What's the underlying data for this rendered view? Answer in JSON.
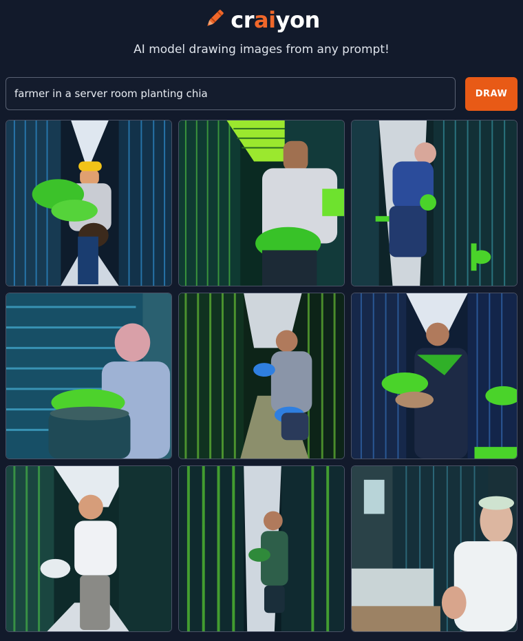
{
  "brand": {
    "name_prefix": "cr",
    "name_accent": "ai",
    "name_suffix": "yon",
    "tagline": "AI model drawing images from any prompt!",
    "logo_icon": "crayon-icon",
    "accent_color": "#f0672a"
  },
  "prompt": {
    "value": "farmer in a server room planting chia"
  },
  "draw_button": {
    "label": "DRAW",
    "color": "#e85a16"
  },
  "results": [
    {
      "id": "result-1"
    },
    {
      "id": "result-2"
    },
    {
      "id": "result-3"
    },
    {
      "id": "result-4"
    },
    {
      "id": "result-5"
    },
    {
      "id": "result-6"
    },
    {
      "id": "result-7"
    },
    {
      "id": "result-8"
    },
    {
      "id": "result-9"
    }
  ]
}
